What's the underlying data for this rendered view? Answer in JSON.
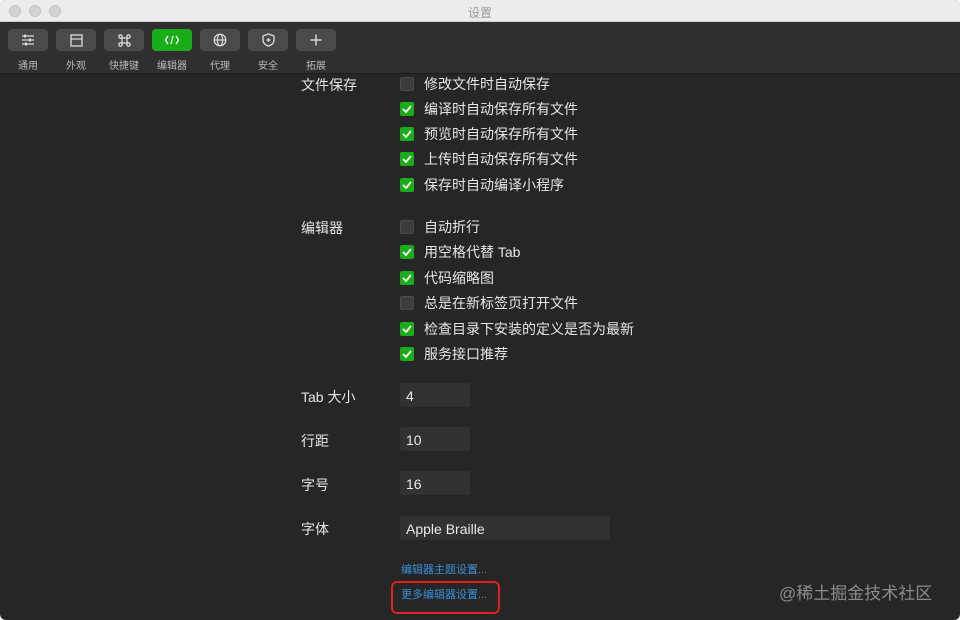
{
  "window": {
    "title": "设置"
  },
  "toolbar": {
    "items": [
      {
        "label": "通用",
        "icon": "sliders-icon"
      },
      {
        "label": "外观",
        "icon": "layout-icon"
      },
      {
        "label": "快捷键",
        "icon": "command-key-icon"
      },
      {
        "label": "编辑器",
        "icon": "code-icon",
        "active": true
      },
      {
        "label": "代理",
        "icon": "globe-icon"
      },
      {
        "label": "安全",
        "icon": "shield-icon"
      },
      {
        "label": "拓展",
        "icon": "plus-icon"
      }
    ],
    "active_color": "#1aad19"
  },
  "file_save": {
    "label": "文件保存",
    "options": [
      {
        "label": "修改文件时自动保存",
        "checked": false
      },
      {
        "label": "编译时自动保存所有文件",
        "checked": true
      },
      {
        "label": "预览时自动保存所有文件",
        "checked": true
      },
      {
        "label": "上传时自动保存所有文件",
        "checked": true
      },
      {
        "label": "保存时自动编译小程序",
        "checked": true
      }
    ]
  },
  "editor": {
    "label": "编辑器",
    "options": [
      {
        "label": "自动折行",
        "checked": false
      },
      {
        "label": "用空格代替 Tab",
        "checked": true
      },
      {
        "label": "代码缩略图",
        "checked": true
      },
      {
        "label": "总是在新标签页打开文件",
        "checked": false
      },
      {
        "label": "检查目录下安装的定义是否为最新",
        "checked": true
      },
      {
        "label": "服务接口推荐",
        "checked": true
      }
    ]
  },
  "tab_size": {
    "label": "Tab 大小",
    "value": "4"
  },
  "line_height": {
    "label": "行距",
    "value": "10"
  },
  "font_size": {
    "label": "字号",
    "value": "16"
  },
  "font_family": {
    "label": "字体",
    "value": "Apple Braille"
  },
  "links": {
    "theme_settings": "编辑器主题设置...",
    "more_settings": "更多编辑器设置..."
  },
  "watermark": "@稀土掘金技术社区"
}
